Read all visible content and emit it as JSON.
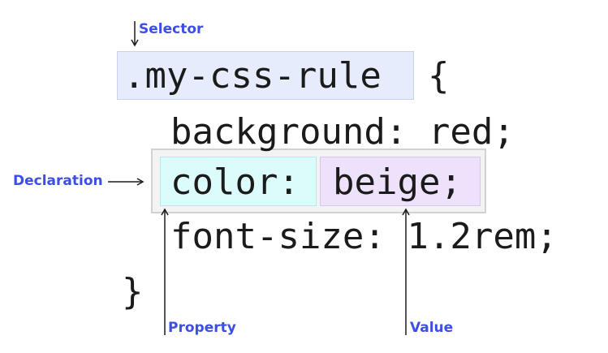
{
  "code": {
    "selector": ".my-css-rule",
    "open_brace": "{",
    "line_background": "background: red;",
    "property": "color:",
    "value": "beige;",
    "line_font_size": "font-size: 1.2rem;",
    "close_brace": "}"
  },
  "annotations": {
    "selector": "Selector",
    "declaration": "Declaration",
    "property": "Property",
    "value": "Value"
  },
  "colors": {
    "label_color": "#3d4ee6",
    "selector_highlight": "#e6ecfb",
    "declaration_highlight": "#f3f3f3",
    "property_highlight": "#dcfbfb",
    "value_highlight": "#ede1fb"
  }
}
